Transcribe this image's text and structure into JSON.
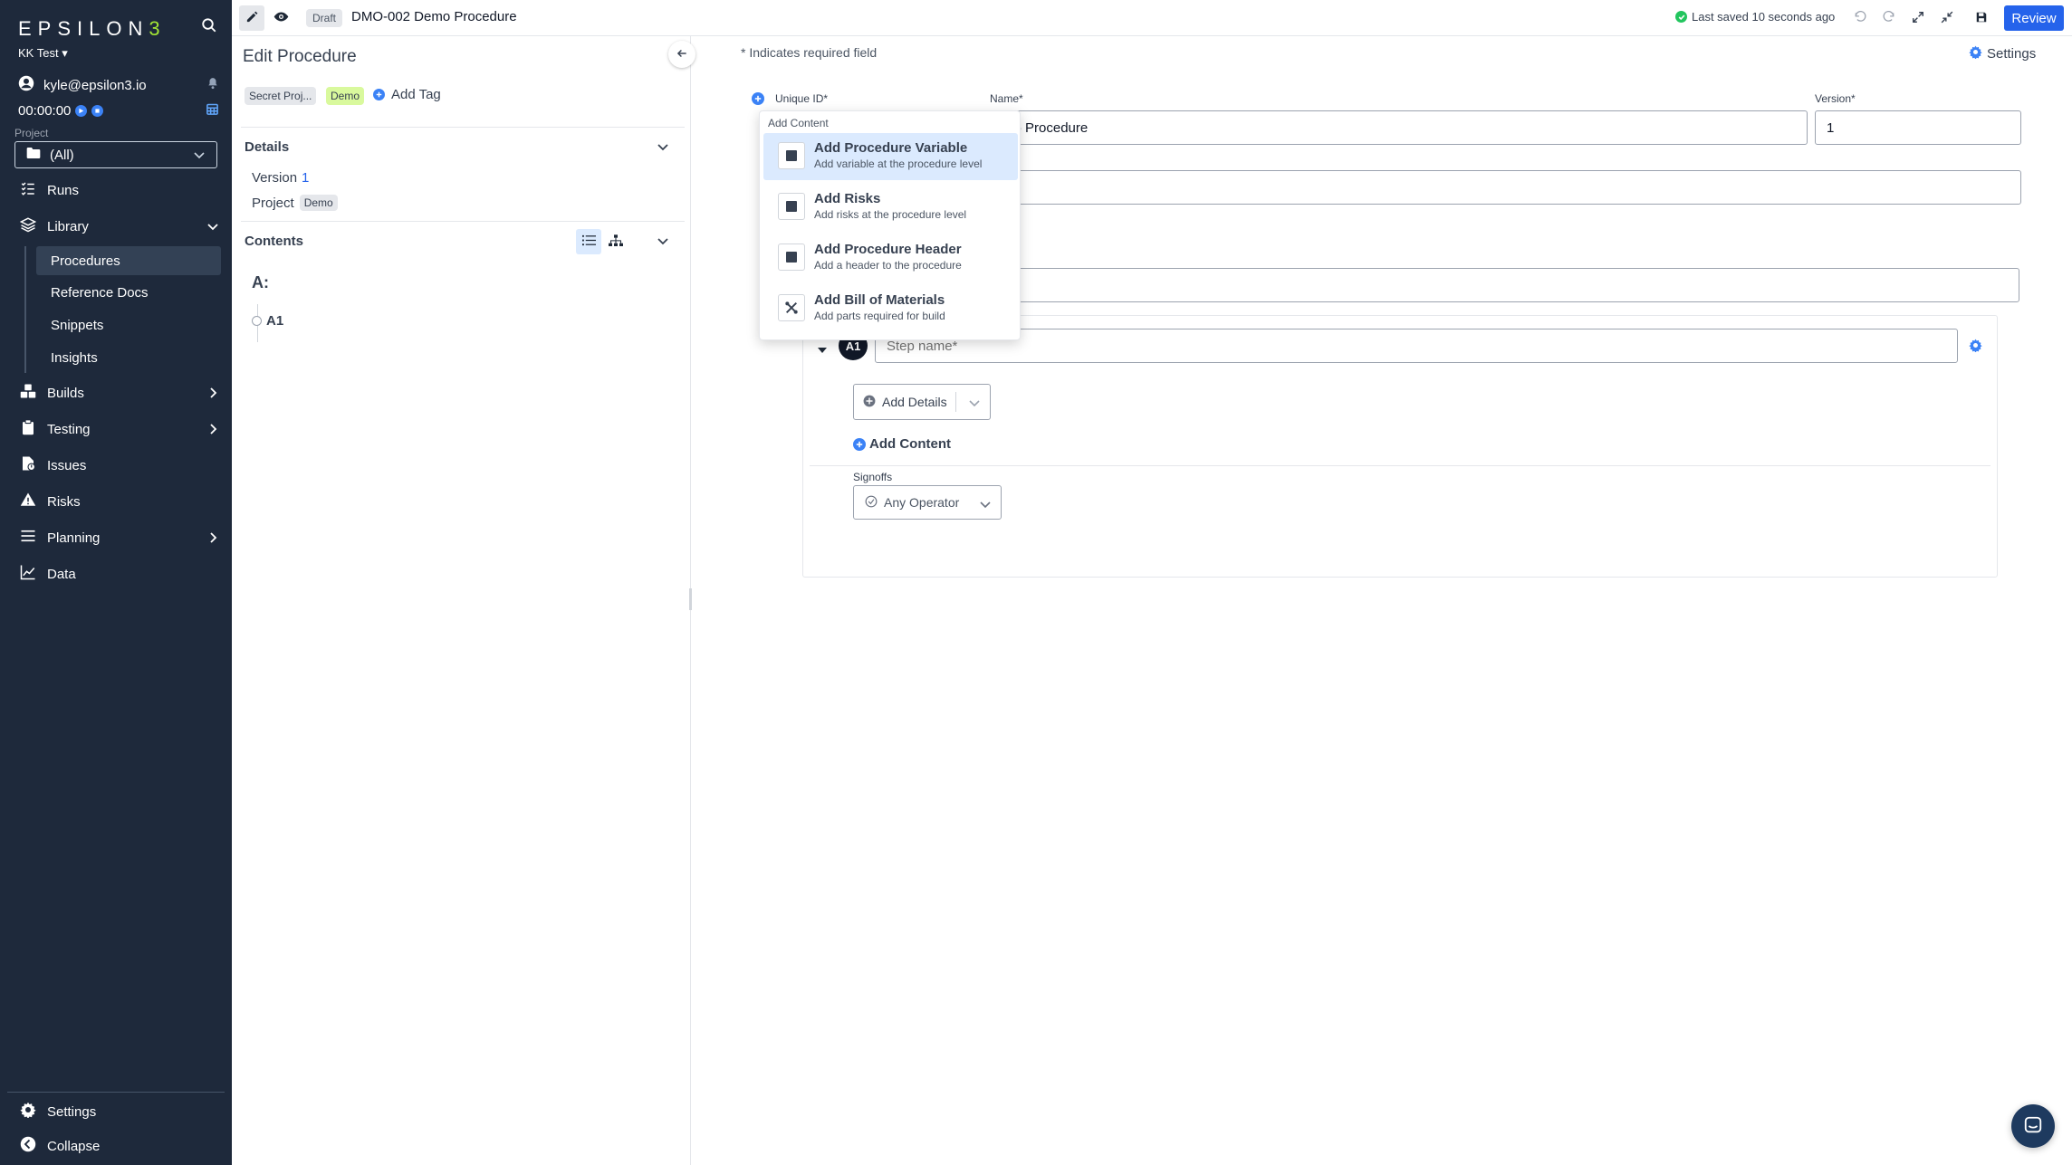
{
  "sidebar": {
    "logo": "EPSILON",
    "logo_accent": "3",
    "org": "KK Test",
    "user": "kyle@epsilon3.io",
    "timer": "00:00:00",
    "project_label": "Project",
    "project_value": "(All)",
    "nav": {
      "runs": "Runs",
      "library": "Library",
      "builds": "Builds",
      "testing": "Testing",
      "issues": "Issues",
      "risks": "Risks",
      "planning": "Planning",
      "data": "Data",
      "settings": "Settings",
      "collapse": "Collapse"
    },
    "library_items": [
      "Procedures",
      "Reference Docs",
      "Snippets",
      "Insights"
    ]
  },
  "topbar": {
    "status_badge": "Draft",
    "title": "DMO-002 Demo Procedure",
    "saved_status": "Last saved 10 seconds ago",
    "review_label": "Review"
  },
  "edit_panel": {
    "title": "Edit Procedure",
    "tags": [
      "Secret Proj...",
      "Demo"
    ],
    "add_tag": "Add Tag",
    "details_title": "Details",
    "version_label": "Version",
    "version_value": "1",
    "project_label": "Project",
    "project_value": "Demo",
    "contents_title": "Contents",
    "section_label": "A:",
    "step_label": "A1"
  },
  "main": {
    "required_note": "* Indicates required field",
    "settings_label": "Settings",
    "unique_id_label": "Unique ID*",
    "name_label": "Name*",
    "name_value": "mo Procedure",
    "version_label": "Version*",
    "version_value": "1",
    "step_badge": "A1",
    "step_name_placeholder": "Step name*",
    "add_details": "Add Details",
    "add_content": "Add Content",
    "signoffs_label": "Signoffs",
    "signoff_value": "Any Operator"
  },
  "dropdown": {
    "header": "Add Content",
    "items": [
      {
        "title": "Add Procedure Variable",
        "subtitle": "Add variable at the procedure level"
      },
      {
        "title": "Add Risks",
        "subtitle": "Add risks at the procedure level"
      },
      {
        "title": "Add Procedure Header",
        "subtitle": "Add a header to the procedure"
      },
      {
        "title": "Add Bill of Materials",
        "subtitle": "Add parts required for build"
      }
    ]
  },
  "colors": {
    "sidebar_bg": "#1e293b",
    "accent_blue": "#2563eb",
    "logo_accent": "#a3e635",
    "saved_green": "#22c55e"
  }
}
